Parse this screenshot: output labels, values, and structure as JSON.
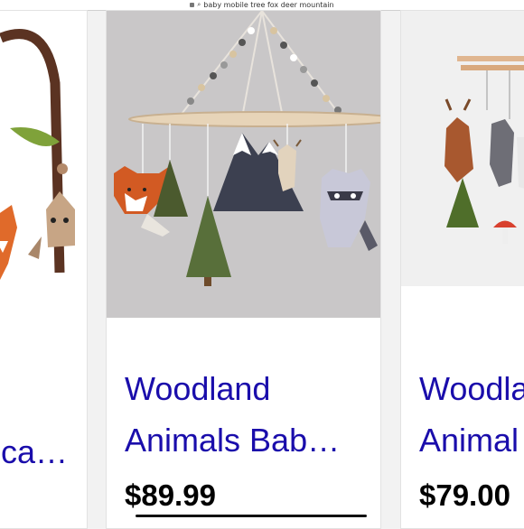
{
  "browser": {
    "url_text": "baby mobile tree fox deer mountain"
  },
  "products": [
    {
      "title_line1": "",
      "title_line2": "ca…",
      "price": ""
    },
    {
      "title_line1": "Woodland",
      "title_line2": "Animals Bab…",
      "price": "$89.99"
    },
    {
      "title_line1": "Woodla",
      "title_line2": "Animal",
      "price": "$79.00"
    }
  ],
  "colors": {
    "link_blue": "#1a0dab",
    "photo_gray": "#c9c7c8"
  }
}
